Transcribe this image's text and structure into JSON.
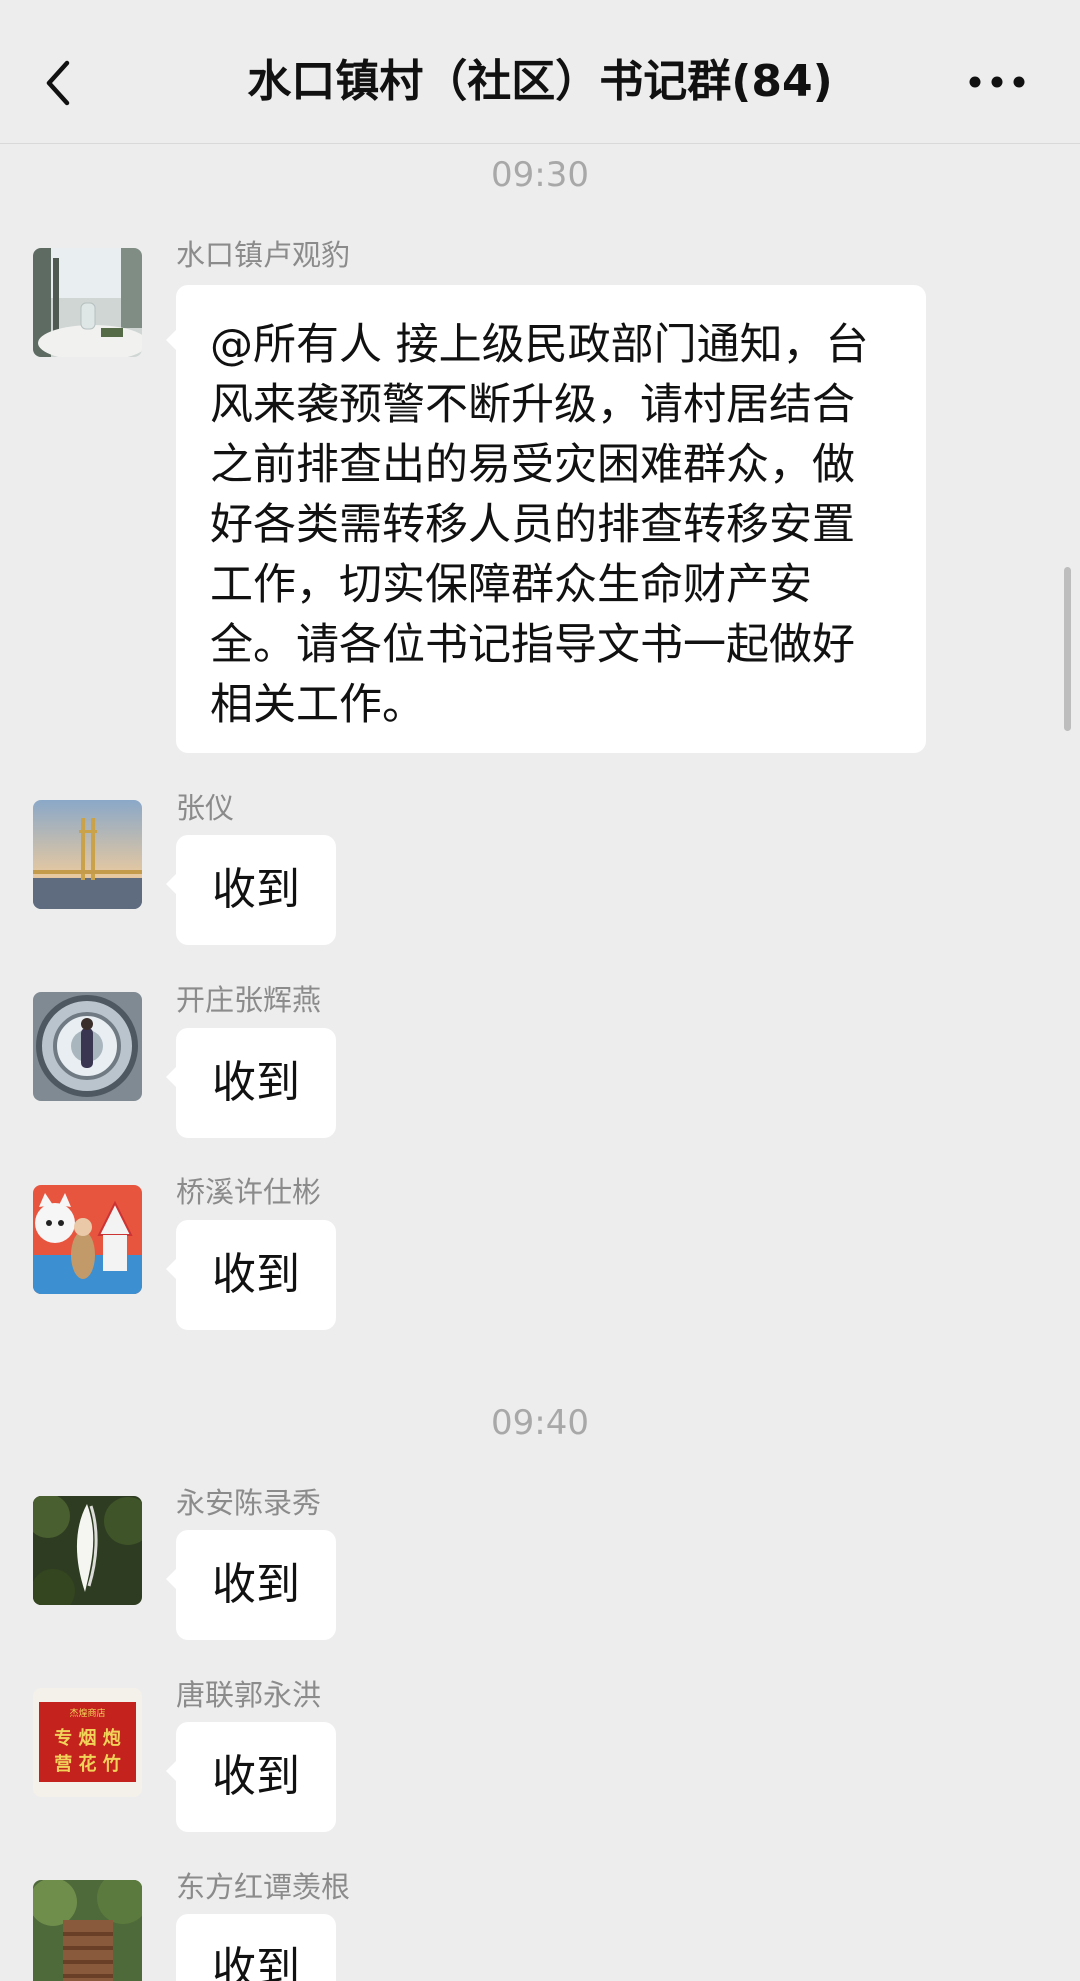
{
  "header": {
    "title": "水口镇村（社区）书记群(84)",
    "back_icon": "chevron-left-icon",
    "more_icon": "ellipsis-icon"
  },
  "timestamps": [
    "09:30",
    "09:40"
  ],
  "messages": [
    {
      "sender": "水口镇卢观豹",
      "text": "@所有人 接上级民政部门通知，台风来袭预警不断升级，请村居结合之前排查出的易受灾困难群众，做好各类需转移人员的排查转移安置工作，切实保障群众生命财产安全。请各位书记指导文书一起做好相关工作。"
    },
    {
      "sender": "张仪",
      "text": "收到"
    },
    {
      "sender": "开庄张辉燕",
      "text": "收到"
    },
    {
      "sender": "桥溪许仕彬",
      "text": "收到"
    },
    {
      "sender": "永安陈录秀",
      "text": "收到"
    },
    {
      "sender": "唐联郭永洪",
      "text": "收到",
      "avatar_sign": {
        "shop": "杰煌商店",
        "row1": "专 烟 炮",
        "row2": "营 花 竹"
      }
    },
    {
      "sender": "东方红谭羡根",
      "text": "收到"
    }
  ],
  "colors": {
    "background": "#ededed",
    "bubble": "#ffffff",
    "sender_name": "#8b8b8b",
    "timestamp": "#a8a8a8"
  }
}
